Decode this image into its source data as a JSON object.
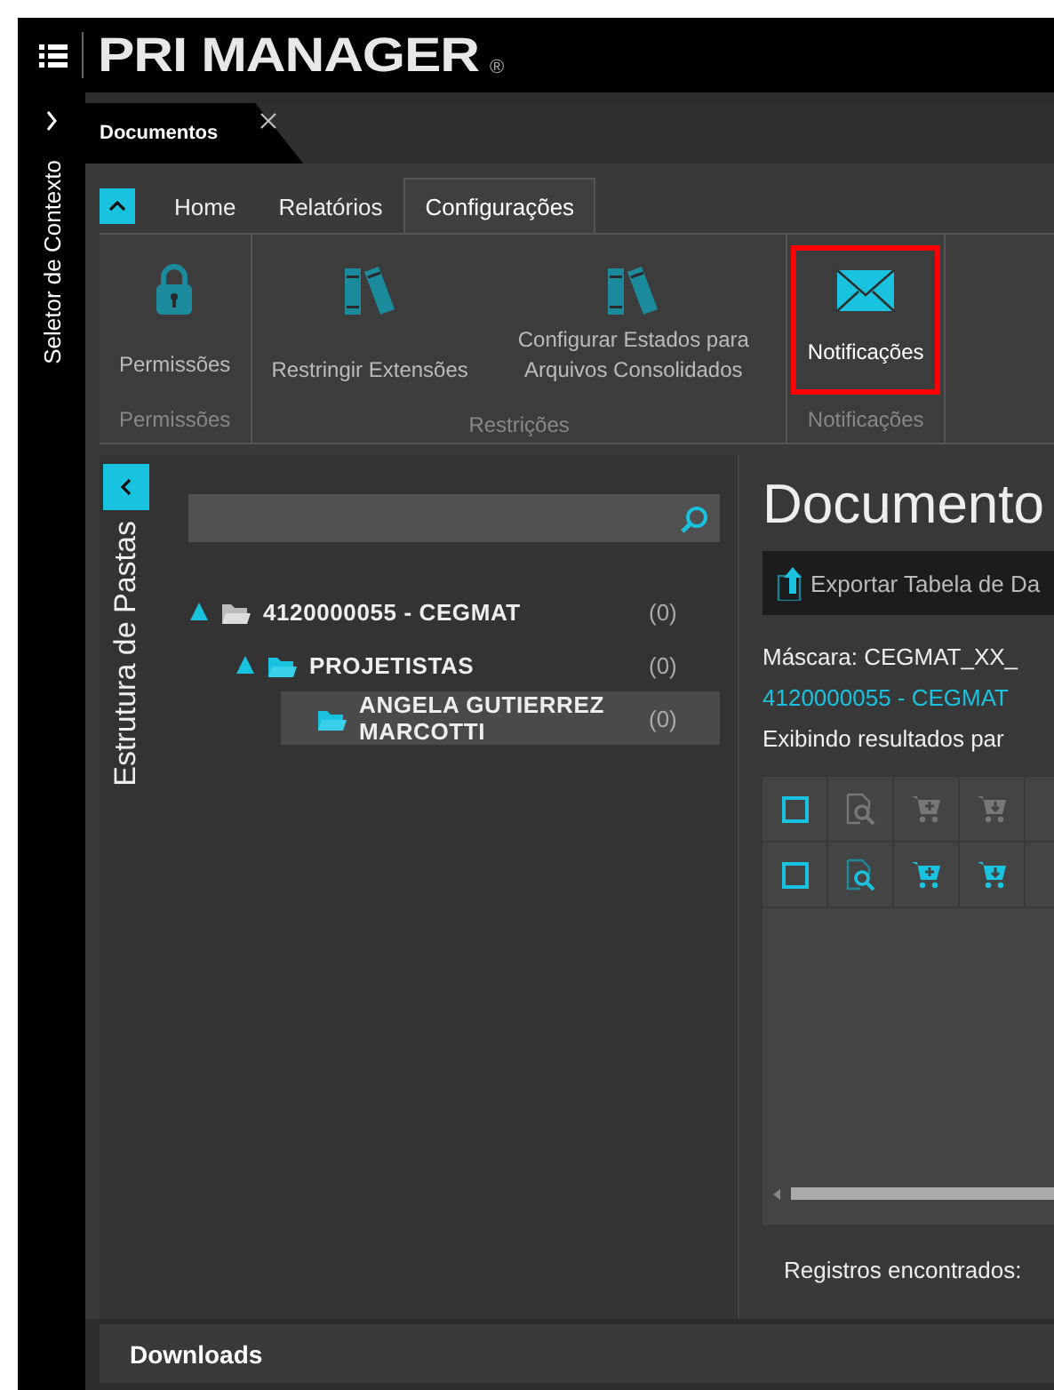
{
  "header": {
    "logo": "PRI MANAGER",
    "registered_mark": "®"
  },
  "context_selector": {
    "label": "Seletor de Contexto",
    "expanded": false
  },
  "document_tabs": [
    {
      "label": "Documentos",
      "selected": true
    }
  ],
  "ribbon": {
    "expanded": true,
    "tabs": [
      {
        "label": "Home",
        "selected": false
      },
      {
        "label": "Relatórios",
        "selected": false
      },
      {
        "label": "Configurações",
        "selected": true
      }
    ],
    "groups": [
      {
        "label": "Permissões",
        "buttons": [
          {
            "kind": "lock",
            "label": "Permissões",
            "highlighted": false
          }
        ]
      },
      {
        "label": "Restrições",
        "buttons": [
          {
            "kind": "books",
            "label": "Restringir Extensões",
            "highlighted": false
          },
          {
            "kind": "books",
            "label": "Configurar Estados para Arquivos Consolidados",
            "highlighted": false
          }
        ]
      },
      {
        "label": "Notificações",
        "buttons": [
          {
            "kind": "envelope",
            "label": "Notificações",
            "highlighted": true
          }
        ]
      }
    ]
  },
  "folder_panel": {
    "title": "Estrutura de Pastas",
    "expanded": true,
    "tree": [
      {
        "label": "4120000055 - CEGMAT",
        "count": "(0)",
        "selected": false,
        "children": [
          {
            "label": "PROJETISTAS",
            "count": "(0)",
            "selected": false,
            "children": [
              {
                "label": "ANGELA GUTIERREZ MARCOTTI",
                "count": "(0)",
                "selected": true
              }
            ]
          }
        ]
      }
    ]
  },
  "documents": {
    "title": "Documento",
    "toolbar": [
      "Exportar Tabela de Da"
    ],
    "mask": "Máscara: CEGMAT_XX_",
    "path": "4120000055 - CEGMAT",
    "showing": "Exibindo resultados par",
    "grid_rows": [
      {
        "checked": false,
        "enabled": false
      },
      {
        "checked": false,
        "enabled": true
      }
    ],
    "records_label": "Registros encontrados:"
  },
  "downloads": {
    "label": "Downloads"
  }
}
